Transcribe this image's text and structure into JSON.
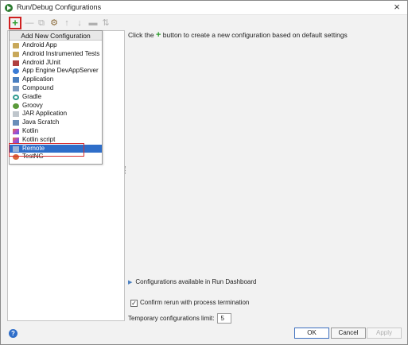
{
  "window": {
    "title": "Run/Debug Configurations"
  },
  "toolbar": {
    "buttons": [
      {
        "name": "add",
        "icon": "plus-icon",
        "glyph": "+"
      },
      {
        "name": "remove",
        "icon": "minus-icon",
        "glyph": "—"
      },
      {
        "name": "copy",
        "icon": "copy-icon",
        "glyph": "⧉"
      },
      {
        "name": "edit-defaults",
        "icon": "wrench-icon",
        "glyph": "⚙"
      },
      {
        "name": "move-up",
        "icon": "arrow-up-icon",
        "glyph": "↑"
      },
      {
        "name": "move-down",
        "icon": "arrow-down-icon",
        "glyph": "↓"
      },
      {
        "name": "folder",
        "icon": "folder-icon",
        "glyph": "▬"
      },
      {
        "name": "sort",
        "icon": "sort-icon",
        "glyph": "⇅"
      }
    ]
  },
  "popup": {
    "header": "Add New Configuration",
    "items": [
      {
        "label": "Android App",
        "icon": "android-icon"
      },
      {
        "label": "Android Instrumented Tests",
        "icon": "android-icon"
      },
      {
        "label": "Android JUnit",
        "icon": "junit-icon"
      },
      {
        "label": "App Engine DevAppServer",
        "icon": "appengine-icon"
      },
      {
        "label": "Application",
        "icon": "application-icon"
      },
      {
        "label": "Compound",
        "icon": "compound-icon"
      },
      {
        "label": "Gradle",
        "icon": "gradle-icon"
      },
      {
        "label": "Groovy",
        "icon": "groovy-icon"
      },
      {
        "label": "JAR Application",
        "icon": "jar-icon"
      },
      {
        "label": "Java Scratch",
        "icon": "scratch-icon"
      },
      {
        "label": "Kotlin",
        "icon": "kotlin-icon"
      },
      {
        "label": "Kotlin script",
        "icon": "kotlin-script-icon"
      },
      {
        "label": "Remote",
        "icon": "remote-icon",
        "selected": true
      },
      {
        "label": "TestNG",
        "icon": "testng-icon"
      }
    ]
  },
  "main": {
    "hint_prefix": "Click the",
    "hint_plus": "+",
    "hint_suffix": "button to create a new configuration based on default settings",
    "dashboard_label": "Configurations available in Run Dashboard",
    "confirm_rerun_label": "Confirm rerun with process termination",
    "confirm_rerun_checked": true,
    "temp_limit_label": "Temporary configurations limit:",
    "temp_limit_value": "5"
  },
  "buttons": {
    "ok": "OK",
    "cancel": "Cancel",
    "apply": "Apply"
  },
  "colors": {
    "selection": "#2f6ec9",
    "highlight_box": "#d83030",
    "plus_green": "#2e9e2e"
  }
}
